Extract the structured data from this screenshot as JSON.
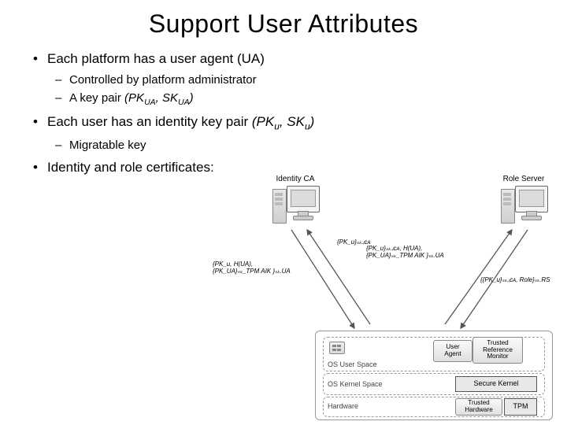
{
  "title": "Support User Attributes",
  "bullets": {
    "b1": "Each platform has a user agent (UA)",
    "b1s1": "Controlled by platform administrator",
    "b1s2_prefix": "A key pair ",
    "b1s2_pk": "(PK",
    "b1s2_pk_sub": "UA",
    "b1s2_mid": ", SK",
    "b1s2_sk_sub": "UA",
    "b1s2_end": ")",
    "b2_prefix": "Each user has an identity key pair ",
    "b2_pk": "(PK",
    "b2_pk_sub": "u",
    "b2_mid": ", SK",
    "b2_sk_sub": "u",
    "b2_end": ")",
    "b2s1": "Migratable key",
    "b3": "Identity and role certificates:"
  },
  "diagram": {
    "identity_ca": "Identity CA",
    "role_server": "Role Server",
    "ann_center": "{PK_u}ₛₖ.ᵢcᴀ, H(UA),\n{PK_UA}ₛₖ_TPM AIK }ₛₖ.UA",
    "ann_left": "{PK_u, H(UA),\n{PK_UA}ₛₖ_TPM AIK }ₛₖ.UA",
    "ann_left_ret": "{PK_u}ₛₖ.ᵢcᴀ",
    "ann_right_ret": "{{PK_u}ₛₖ.ᵢcᴀ, Role}ₛₖ.RS",
    "os_user": "OS User Space",
    "os_kernel": "OS Kernel Space",
    "hardware": "Hardware",
    "user_agent": "User\nAgent",
    "trm": "Trusted\nReference\nMonitor",
    "secure_kernel": "Secure Kernel",
    "trusted_hw": "Trusted\nHardware",
    "tpm": "TPM"
  }
}
